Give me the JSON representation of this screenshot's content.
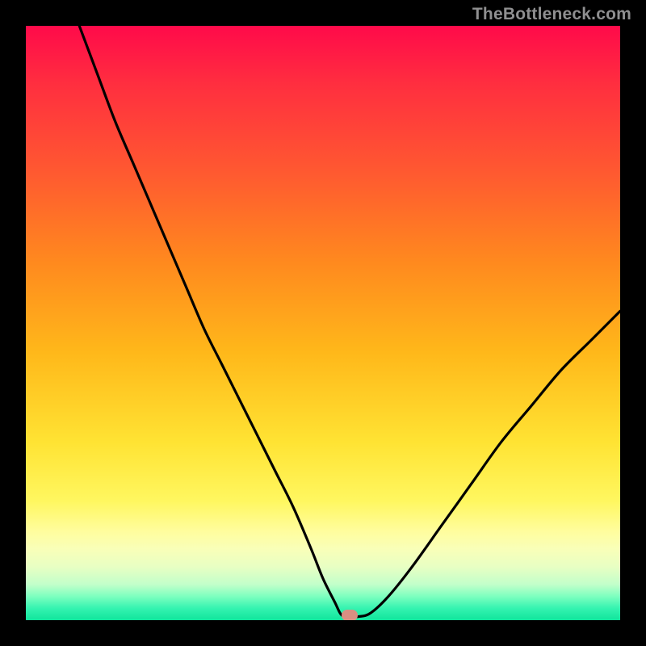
{
  "watermark": "TheBottleneck.com",
  "chart_data": {
    "type": "line",
    "title": "",
    "xlabel": "",
    "ylabel": "",
    "xlim": [
      0,
      100
    ],
    "ylim": [
      0,
      100
    ],
    "grid": false,
    "legend": false,
    "notes": "Single V-shaped bottleneck curve over a vertical red→yellow→green gradient. Minimum at x≈54. An orange/pink capsule marker sits at the curve minimum near the bottom band.",
    "series": [
      {
        "name": "curve",
        "color": "#000000",
        "x": [
          9,
          12,
          15,
          18,
          21,
          24,
          27,
          30,
          33,
          36,
          39,
          42,
          45,
          48,
          50,
          52,
          53,
          54,
          56,
          58,
          61,
          65,
          70,
          75,
          80,
          85,
          90,
          95,
          100
        ],
        "y": [
          100,
          92,
          84,
          77,
          70,
          63,
          56,
          49,
          43,
          37,
          31,
          25,
          19,
          12,
          7,
          3,
          1,
          0.6,
          0.6,
          1.2,
          4,
          9,
          16,
          23,
          30,
          36,
          42,
          47,
          52
        ]
      }
    ],
    "marker": {
      "x": 54.5,
      "y": 0.8
    },
    "gradient_stops": [
      {
        "pos": 0,
        "color": "#ff0a4a"
      },
      {
        "pos": 25,
        "color": "#ff5a30"
      },
      {
        "pos": 55,
        "color": "#ffb81a"
      },
      {
        "pos": 80,
        "color": "#fff760"
      },
      {
        "pos": 94,
        "color": "#c2ffca"
      },
      {
        "pos": 100,
        "color": "#10e59c"
      }
    ]
  }
}
